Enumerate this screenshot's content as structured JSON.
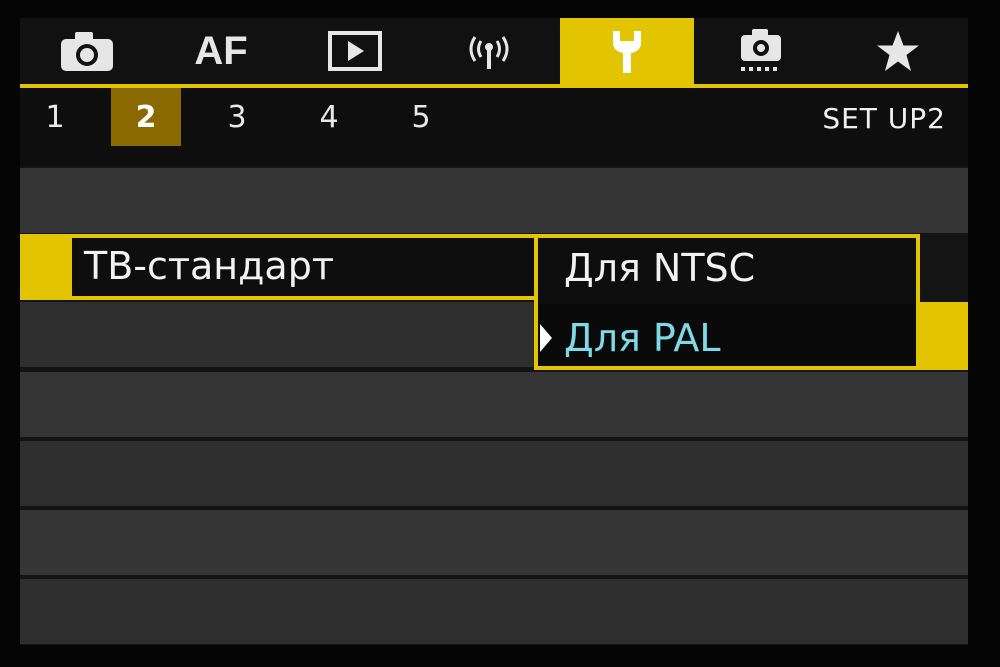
{
  "tabs": [
    {
      "name": "tab-shooting",
      "icon": "camera-icon",
      "label": ""
    },
    {
      "name": "tab-af",
      "icon": "",
      "label": "AF"
    },
    {
      "name": "tab-playback",
      "icon": "play-icon",
      "label": ""
    },
    {
      "name": "tab-wireless",
      "icon": "wireless-icon",
      "label": ""
    },
    {
      "name": "tab-setup",
      "icon": "wrench-icon",
      "label": "",
      "active": true
    },
    {
      "name": "tab-custom-functions",
      "icon": "custom-camera-icon",
      "label": ""
    },
    {
      "name": "tab-my-menu",
      "icon": "star-icon",
      "label": ""
    }
  ],
  "subtabs": [
    "1",
    "2",
    "3",
    "4",
    "5"
  ],
  "active_subtab": "2",
  "page_title": "SET UP2",
  "setting": {
    "label": "ТВ-стандарт",
    "options": [
      "Для NTSC",
      "Для PAL"
    ],
    "selected": "Для PAL"
  },
  "colors": {
    "accent": "#e3c400",
    "selected_option": "#7fd9e6",
    "row": "#353535",
    "background": "#141414"
  }
}
